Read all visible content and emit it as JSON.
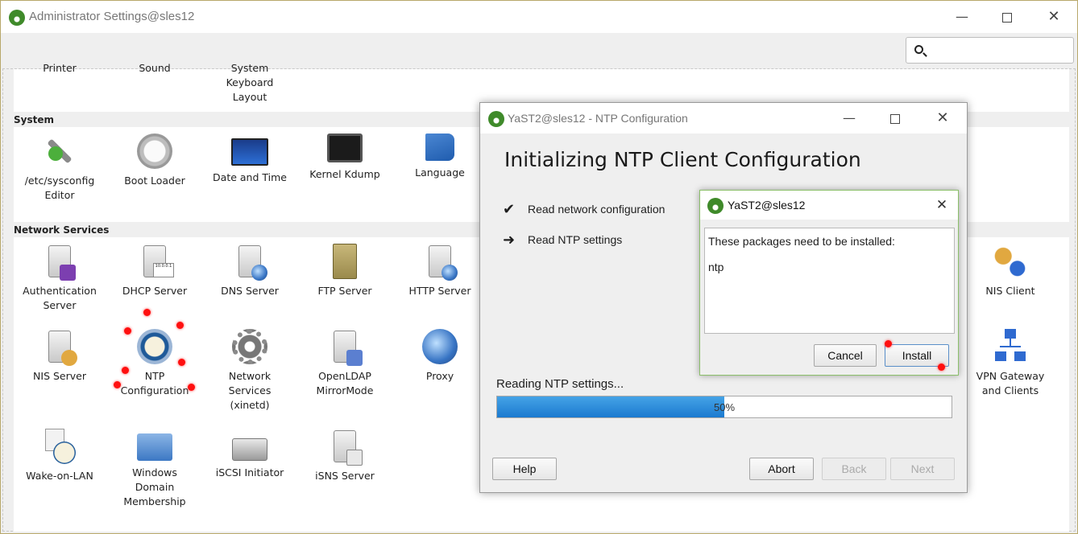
{
  "main_window": {
    "title": "Administrator Settings@sles12",
    "controls": {
      "minimize": "—",
      "maximize": "",
      "close": "✕"
    },
    "search": {
      "value": "",
      "placeholder": ""
    }
  },
  "categories": {
    "top_row": [
      {
        "label": "Printer"
      },
      {
        "label": "Sound"
      },
      {
        "label": "System\nKeyboard\nLayout"
      }
    ],
    "system": {
      "title": "System",
      "modules": [
        {
          "label": "/etc/sysconfig\nEditor",
          "icon": "wrench-icon"
        },
        {
          "label": "Boot Loader",
          "icon": "power-icon"
        },
        {
          "label": "Date and Time",
          "icon": "world-map-icon"
        },
        {
          "label": "Kernel Kdump",
          "icon": "monitor-icon"
        },
        {
          "label": "Language",
          "icon": "flag-icon"
        }
      ]
    },
    "network_services": {
      "title": "Network Services",
      "modules": [
        {
          "label": "Authentication\nServer",
          "icon": "auth-server-icon"
        },
        {
          "label": "DHCP Server",
          "icon": "dhcp-server-icon"
        },
        {
          "label": "DNS Server",
          "icon": "dns-server-icon"
        },
        {
          "label": "FTP Server",
          "icon": "ftp-cabinet-icon"
        },
        {
          "label": "HTTP Server",
          "icon": "http-server-icon"
        },
        {
          "label": "NIS Client",
          "icon": "nis-client-icon"
        },
        {
          "label": "NIS Server",
          "icon": "nis-server-icon"
        },
        {
          "label": "NTP\nConfiguration",
          "icon": "clock-icon"
        },
        {
          "label": "Network\nServices\n(xinetd)",
          "icon": "gear-icon"
        },
        {
          "label": "OpenLDAP\nMirrorMode",
          "icon": "ldap-server-icon"
        },
        {
          "label": "Proxy",
          "icon": "proxy-globe-icon"
        },
        {
          "label": "VPN Gateway\nand Clients",
          "icon": "network-icon"
        },
        {
          "label": "Wake-on-LAN",
          "icon": "wake-on-lan-icon"
        },
        {
          "label": "Windows\nDomain\nMembership",
          "icon": "windows-folder-icon"
        },
        {
          "label": "iSCSI Initiator",
          "icon": "disk-icon"
        },
        {
          "label": "iSNS Server",
          "icon": "isns-server-icon"
        }
      ]
    }
  },
  "ntp_dialog": {
    "title": "YaST2@sles12 - NTP Configuration",
    "heading": "Initializing NTP Client Configuration",
    "steps": [
      {
        "mark": "✔",
        "label": "Read network configuration",
        "state": "done"
      },
      {
        "mark": "➜",
        "label": "Read NTP settings",
        "state": "current"
      }
    ],
    "progress": {
      "label": "Reading NTP settings...",
      "percent": 50,
      "text": "50%"
    },
    "buttons": {
      "help": "Help",
      "abort": "Abort",
      "back": "Back",
      "next": "Next"
    },
    "accent_color": "#1b7ad0"
  },
  "package_prompt": {
    "title": "YaST2@sles12",
    "message": "These packages need to be installed:",
    "packages": [
      "ntp"
    ],
    "buttons": {
      "cancel": "Cancel",
      "install": "Install"
    },
    "border_color": "#8bbf6a"
  }
}
